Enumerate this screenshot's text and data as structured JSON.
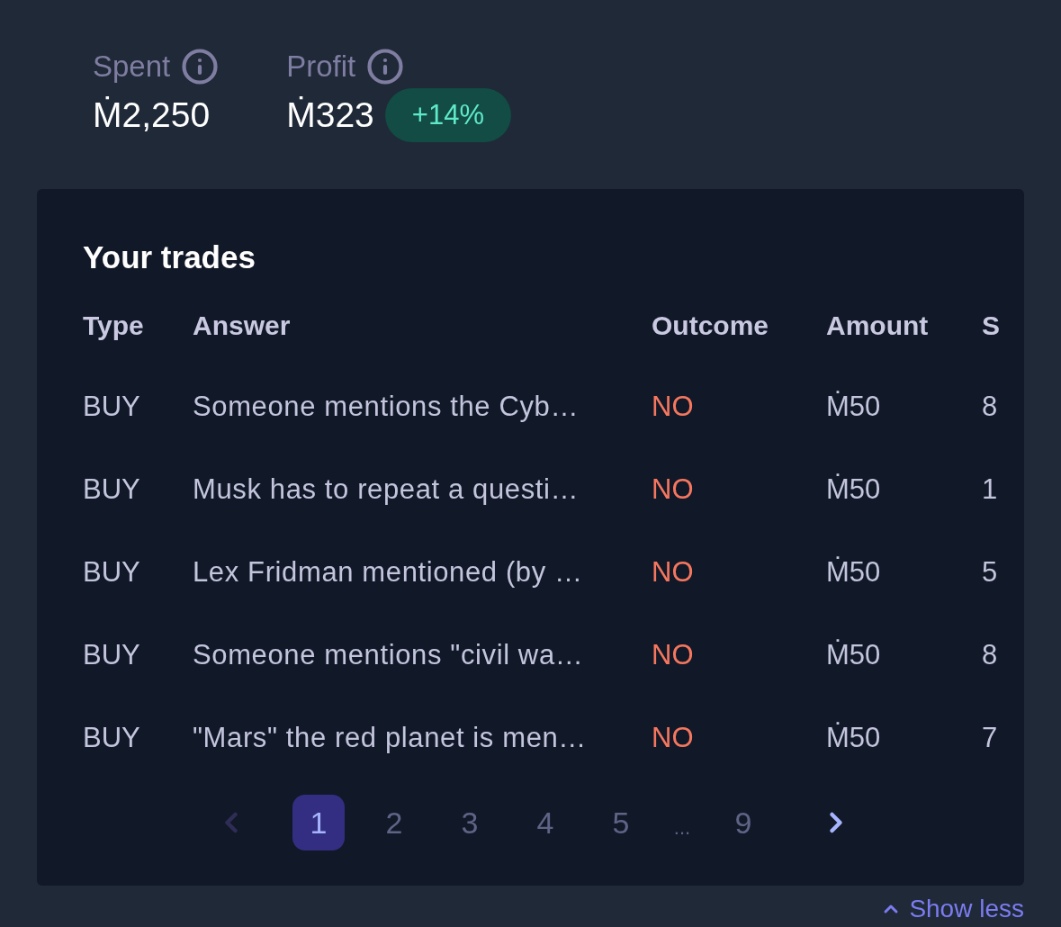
{
  "stats": [
    {
      "label": "Spent",
      "value": "Ṁ2,250"
    },
    {
      "label": "Profit",
      "value": "Ṁ323",
      "badge": "+14%"
    }
  ],
  "trades": {
    "title": "Your trades",
    "columns": [
      "Type",
      "Answer",
      "Outcome",
      "Amount",
      "S"
    ],
    "rows": [
      {
        "type": "BUY",
        "answer": "Someone mentions the Cyb…",
        "outcome": "NO",
        "amount": "Ṁ50",
        "column_5": "8"
      },
      {
        "type": "BUY",
        "answer": "Musk has to repeat a questi…",
        "outcome": "NO",
        "amount": "Ṁ50",
        "column_5": "1"
      },
      {
        "type": "BUY",
        "answer": "Lex Fridman mentioned (by …",
        "outcome": "NO",
        "amount": "Ṁ50",
        "column_5": "5"
      },
      {
        "type": "BUY",
        "answer": "Someone mentions \"civil wa…",
        "outcome": "NO",
        "amount": "Ṁ50",
        "column_5": "8"
      },
      {
        "type": "BUY",
        "answer": "\"Mars\" the red planet is men…",
        "outcome": "NO",
        "amount": "Ṁ50",
        "column_5": "7"
      }
    ]
  },
  "pagination": {
    "prev": {
      "disabled": true
    },
    "pages": [
      {
        "kind": "page",
        "label": "1",
        "selected": true
      },
      {
        "kind": "page",
        "label": "2",
        "selected": false
      },
      {
        "kind": "page",
        "label": "3",
        "selected": false
      },
      {
        "kind": "page",
        "label": "4",
        "selected": false
      },
      {
        "kind": "page",
        "label": "5",
        "selected": false
      },
      {
        "kind": "ellipsis",
        "label": "...",
        "selected": false
      },
      {
        "kind": "page",
        "label": "9",
        "selected": false
      }
    ],
    "next": {
      "disabled": false
    }
  },
  "toggle": {
    "label": "Show less"
  }
}
